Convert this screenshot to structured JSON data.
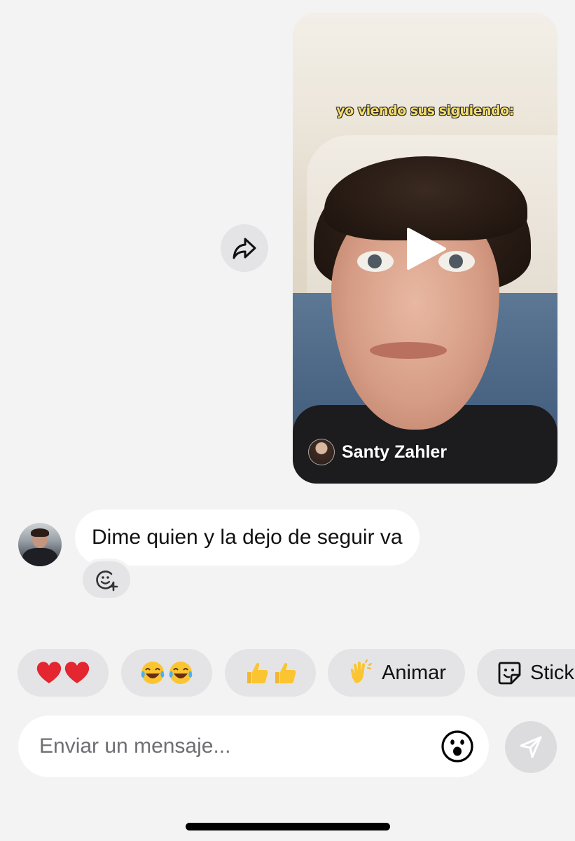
{
  "shared_video": {
    "caption": "yo viendo sus siguiendo:",
    "author_name": "Santy Zahler",
    "play_icon": "play-icon"
  },
  "forward_icon": "share-arrow-icon",
  "message": {
    "text": "Dime quien y la dejo de seguir va",
    "add_reaction_icon": "add-reaction-icon"
  },
  "quick_replies": [
    {
      "emoji": "❤️❤️",
      "label": ""
    },
    {
      "emoji": "😂😂",
      "label": ""
    },
    {
      "emoji": "👍👍",
      "label": ""
    },
    {
      "emoji": "👏",
      "label": "Animar"
    },
    {
      "icon": "sticker-icon",
      "label": "Stick"
    }
  ],
  "composer": {
    "placeholder": "Enviar un mensaje...",
    "emoji_icon": "smiley-icon",
    "send_icon": "send-icon"
  },
  "colors": {
    "background": "#f3f3f3",
    "bubble": "#ffffff",
    "chip": "#e4e4e6",
    "caption": "#f5dd6b"
  }
}
